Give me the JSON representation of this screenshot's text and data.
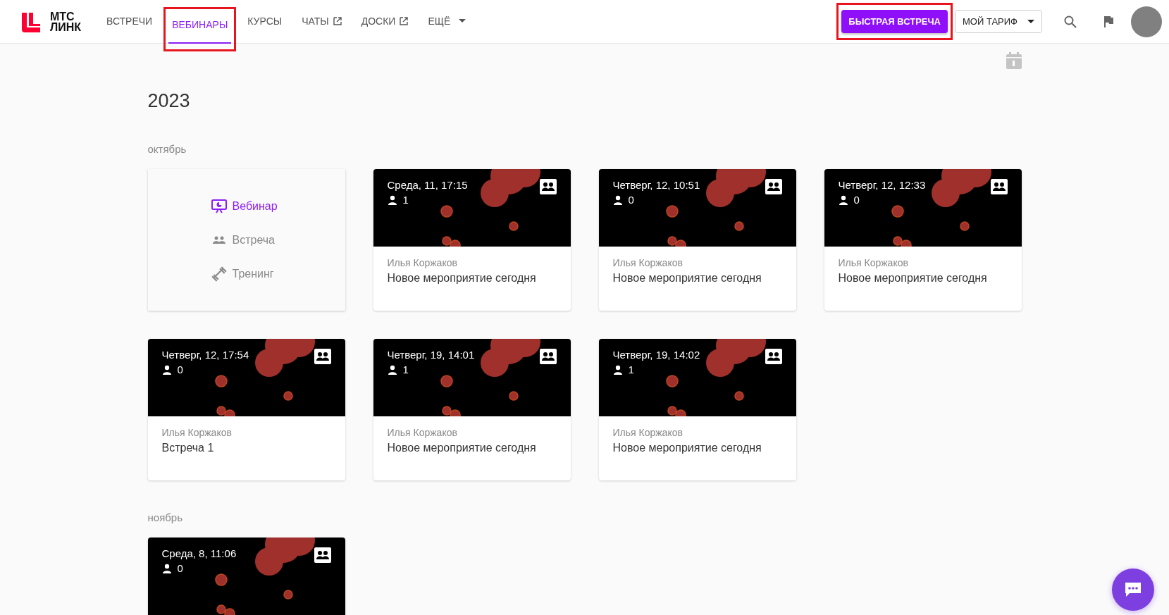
{
  "header": {
    "logo_text": [
      "МТС",
      "ЛИНК"
    ],
    "nav": [
      {
        "label": "ВСТРЕЧИ",
        "selected": false,
        "highlighted": false,
        "external": false,
        "dropdown": false
      },
      {
        "label": "ВЕБИНАРЫ",
        "selected": true,
        "highlighted": true,
        "external": false,
        "dropdown": false
      },
      {
        "label": "КУРСЫ",
        "selected": false,
        "highlighted": false,
        "external": false,
        "dropdown": false
      },
      {
        "label": "ЧАТЫ",
        "selected": false,
        "highlighted": false,
        "external": true,
        "dropdown": false
      },
      {
        "label": "ДОСКИ",
        "selected": false,
        "highlighted": false,
        "external": true,
        "dropdown": false
      },
      {
        "label": "ЕЩЁ",
        "selected": false,
        "highlighted": false,
        "external": false,
        "dropdown": true
      }
    ],
    "quick_button": {
      "label": "БЫСТРАЯ ВСТРЕЧА",
      "highlighted": true
    },
    "plan_button": {
      "label": "МОЙ ТАРИФ"
    }
  },
  "year": "2023",
  "months": [
    {
      "name": "октябрь",
      "create_panel": {
        "options": [
          {
            "kind": "webinar",
            "label": "Вебинар",
            "selected": true
          },
          {
            "kind": "meeting",
            "label": "Встреча",
            "selected": false
          },
          {
            "kind": "training",
            "label": "Тренинг",
            "selected": false
          }
        ]
      },
      "events": [
        {
          "date": "Среда, 11, 17:15",
          "participants": "1",
          "author": "Илья Коржаков",
          "title": "Новое мероприятие сегодня"
        },
        {
          "date": "Четверг, 12, 10:51",
          "participants": "0",
          "author": "Илья Коржаков",
          "title": "Новое мероприятие сегодня"
        },
        {
          "date": "Четверг, 12, 12:33",
          "participants": "0",
          "author": "Илья Коржаков",
          "title": "Новое мероприятие сегодня"
        },
        {
          "date": "Четверг, 12, 17:54",
          "participants": "0",
          "author": "Илья Коржаков",
          "title": "Встреча 1"
        },
        {
          "date": "Четверг, 19, 14:01",
          "participants": "1",
          "author": "Илья Коржаков",
          "title": "Новое мероприятие сегодня"
        },
        {
          "date": "Четверг, 19, 14:02",
          "participants": "1",
          "author": "Илья Коржаков",
          "title": "Новое мероприятие сегодня"
        }
      ]
    },
    {
      "name": "ноябрь",
      "events": [
        {
          "date": "Среда, 8, 11:06",
          "participants": "0"
        }
      ]
    }
  ]
}
